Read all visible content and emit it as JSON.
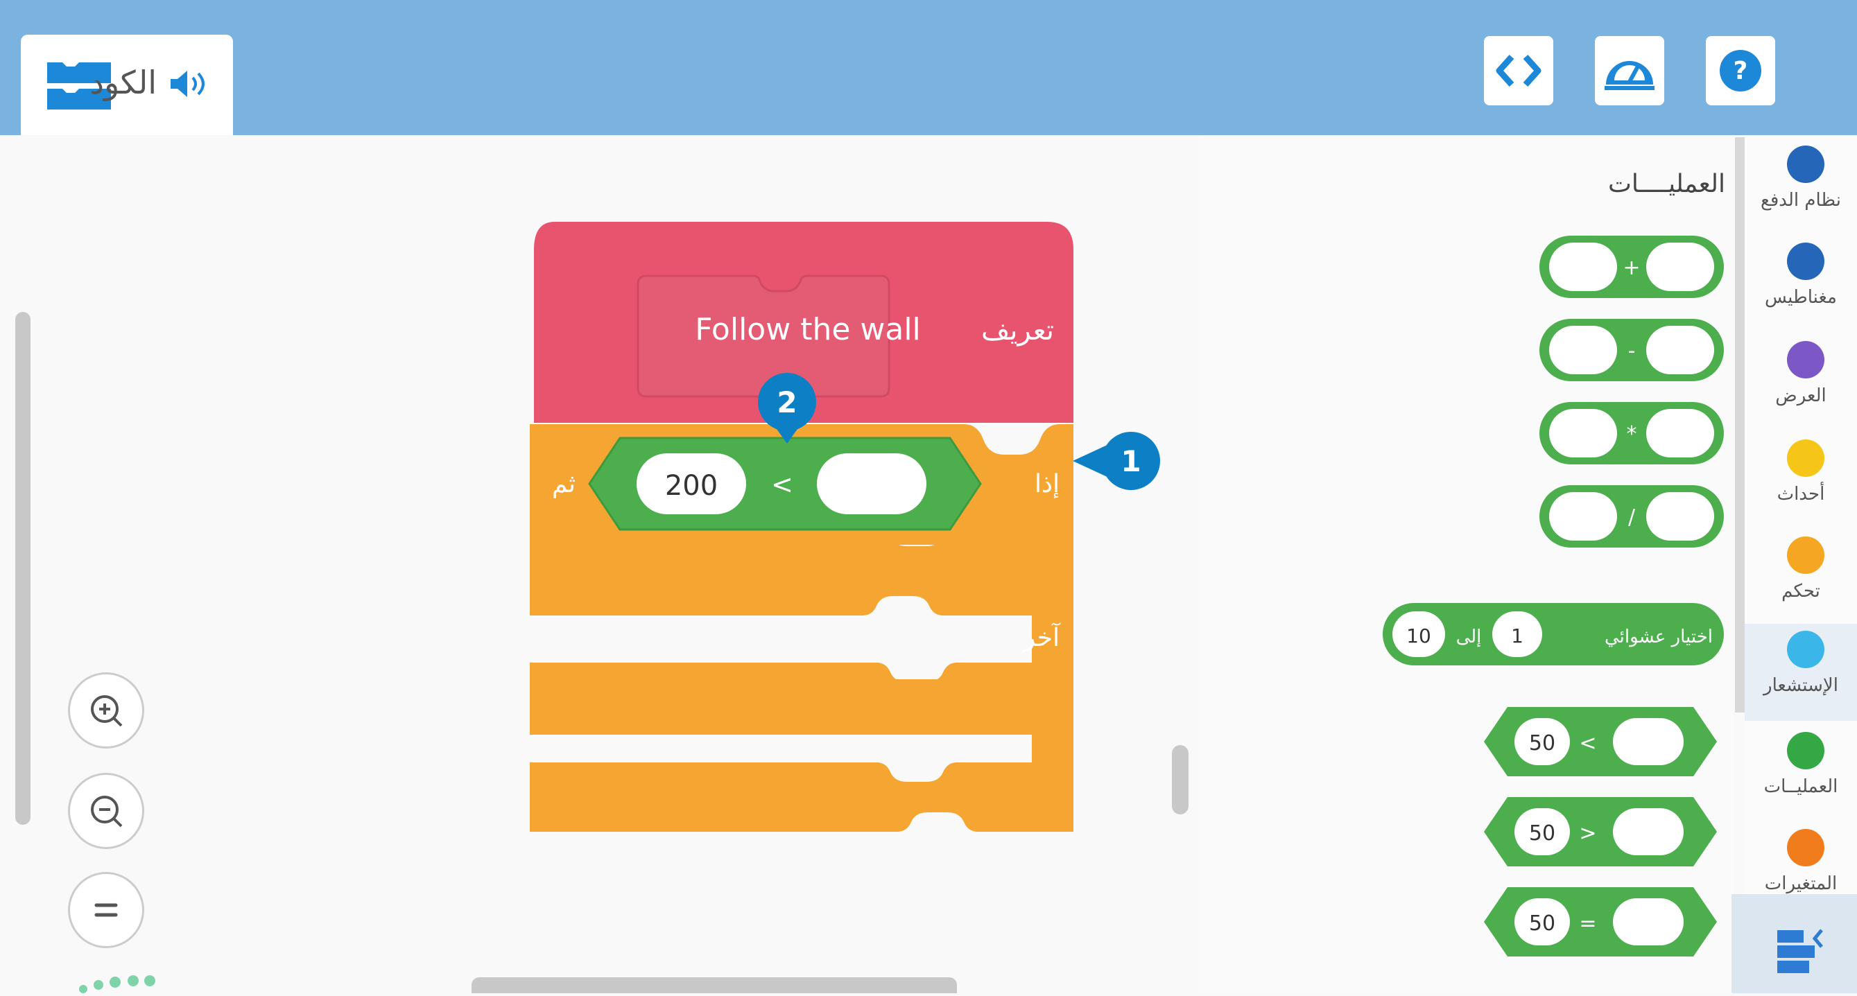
{
  "header": {
    "code_tab_label": "الكود",
    "buttons": [
      "code-view-button",
      "dashboard-button",
      "help-button"
    ]
  },
  "script": {
    "define_label": "تعريف",
    "procedure_name": "Follow the wall",
    "if_label": "إذا",
    "then_label": "ثم",
    "else_label": "آخر",
    "operator": "<",
    "left_value": "200",
    "right_value": ""
  },
  "callouts": [
    "1",
    "2"
  ],
  "flyout": {
    "title": "العمليــــات",
    "arith_ops": [
      "+",
      "-",
      "*",
      "/"
    ],
    "random": {
      "label": "اختيار عشوائي",
      "from": "1",
      "to_label": "إلى",
      "to": "10"
    },
    "compare_blocks": [
      {
        "left": "50",
        "op": "<"
      },
      {
        "left": "50",
        "op": ">"
      },
      {
        "left": "50",
        "op": "="
      }
    ]
  },
  "categories": [
    {
      "label": "نظام الدفع",
      "color": "#2566b8"
    },
    {
      "label": "مغناطيس",
      "color": "#2566b8"
    },
    {
      "label": "العرض",
      "color": "#7b58c5"
    },
    {
      "label": "أحداث",
      "color": "#f5c518"
    },
    {
      "label": "تحكم",
      "color": "#f5a623"
    },
    {
      "label": "الإستشعار",
      "color": "#3ab6e8"
    },
    {
      "label": "العمليــات",
      "color": "#33a845"
    },
    {
      "label": "المتغيرات",
      "color": "#f07c1c"
    }
  ],
  "colors": {
    "topbar": "#7ab3e0",
    "define_block": "#e8546e",
    "control_block": "#f5a632",
    "operator_block": "#4cae4c",
    "callout": "#0d7fc5"
  }
}
